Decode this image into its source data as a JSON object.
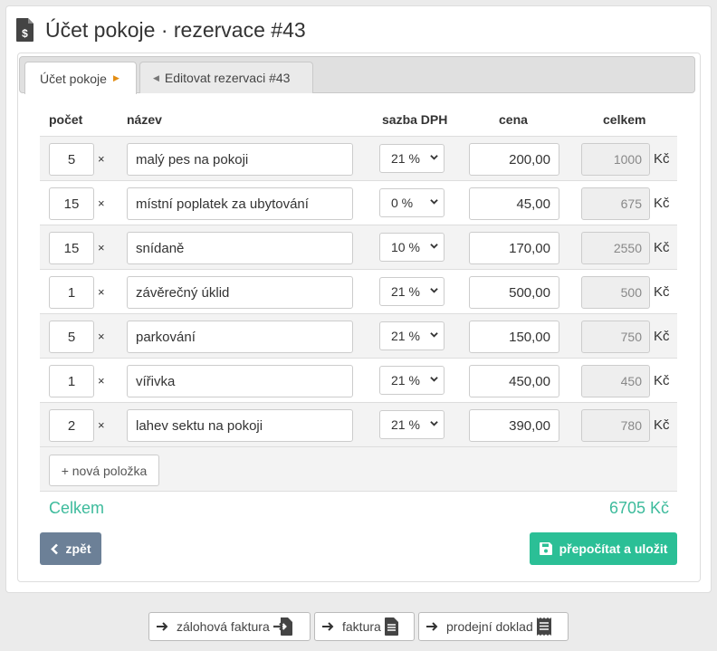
{
  "header": {
    "title": "Účet pokoje · rezervace #43",
    "icon": "invoice-dollar-icon"
  },
  "tabs": [
    {
      "label": "Účet pokoje",
      "active": true
    },
    {
      "label": "Editovat rezervaci #43",
      "active": false
    }
  ],
  "columns": {
    "qty": "počet",
    "name": "název",
    "vat": "sazba DPH",
    "price": "cena",
    "total": "celkem"
  },
  "rows": [
    {
      "qty": "5",
      "times": "×",
      "name": "malý pes na pokoji",
      "vat": "21 %",
      "price": "200,00",
      "total": "1000",
      "currency": "Kč"
    },
    {
      "qty": "15",
      "times": "×",
      "name": "místní poplatek za ubytování",
      "vat": "0 %",
      "price": "45,00",
      "total": "675",
      "currency": "Kč"
    },
    {
      "qty": "15",
      "times": "×",
      "name": "snídaně",
      "vat": "10 %",
      "price": "170,00",
      "total": "2550",
      "currency": "Kč"
    },
    {
      "qty": "1",
      "times": "×",
      "name": "závěrečný úklid",
      "vat": "21 %",
      "price": "500,00",
      "total": "500",
      "currency": "Kč"
    },
    {
      "qty": "5",
      "times": "×",
      "name": "parkování",
      "vat": "21 %",
      "price": "150,00",
      "total": "750",
      "currency": "Kč"
    },
    {
      "qty": "1",
      "times": "×",
      "name": "vířivka",
      "vat": "21 %",
      "price": "450,00",
      "total": "450",
      "currency": "Kč"
    },
    {
      "qty": "2",
      "times": "×",
      "name": "lahev sektu na pokoji",
      "vat": "21 %",
      "price": "390,00",
      "total": "780",
      "currency": "Kč"
    }
  ],
  "add_item_label": "+ nová položka",
  "summary": {
    "label": "Celkem",
    "value": "6705 Kč"
  },
  "buttons": {
    "back": "zpět",
    "save": "přepočítat a uložit"
  },
  "footer": [
    {
      "label": "zálohová faktura",
      "icon": "file-import-icon"
    },
    {
      "label": "faktura",
      "icon": "file-invoice-icon"
    },
    {
      "label": "prodejní doklad",
      "icon": "receipt-icon"
    }
  ],
  "colors": {
    "accent": "#2bbf96",
    "total_text": "#3dbb9c",
    "back_button": "#6c8097",
    "tab_caret": "#e38d13"
  }
}
